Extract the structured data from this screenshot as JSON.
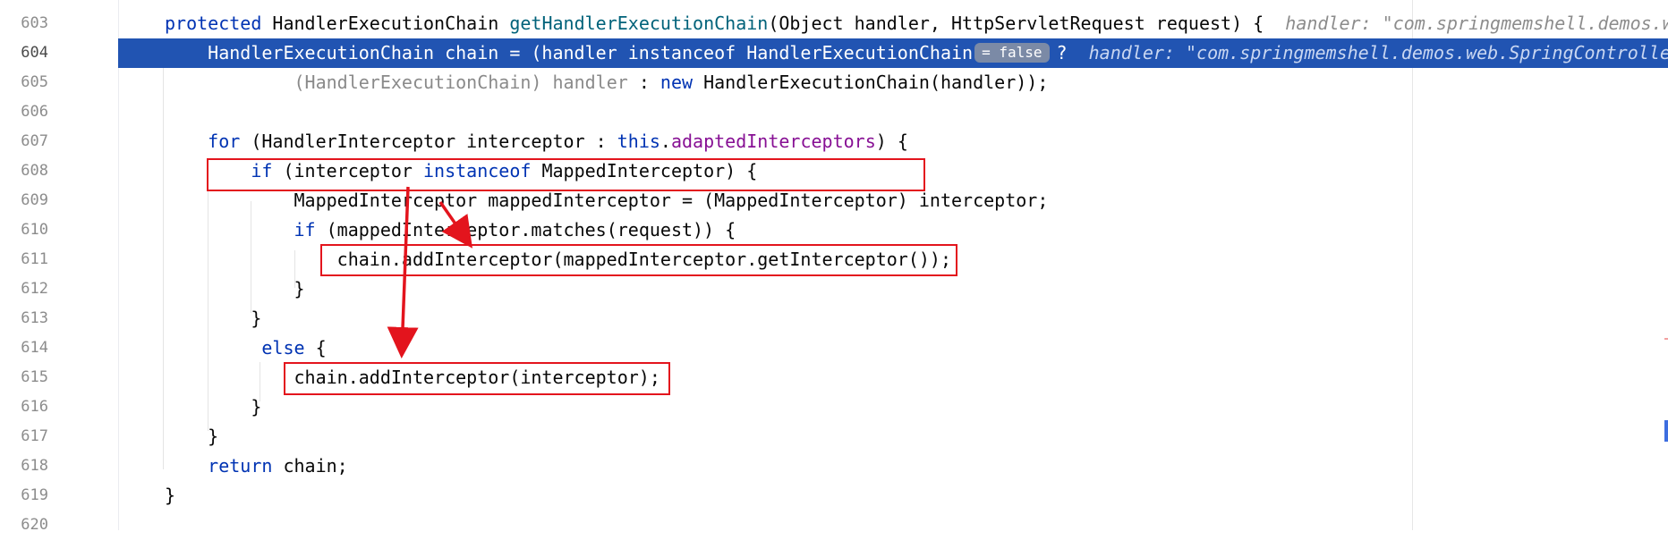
{
  "editor": {
    "lines": [
      {
        "num": "603",
        "parts": [
          {
            "t": "protected ",
            "c": "kw"
          },
          {
            "t": "HandlerExecutionChain "
          },
          {
            "t": "getHandlerExecutionChain",
            "c": "fn"
          },
          {
            "t": "(Object handler, HttpServletRequest request) {  "
          },
          {
            "t": "handler: \"com.springmemshell.demos.w",
            "c": "inlay-hint"
          }
        ]
      },
      {
        "num": "604",
        "current": true,
        "parts": [
          {
            "t": "    HandlerExecutionChain chain = (handler instanceof HandlerExecutionChain"
          },
          {
            "t": "= false",
            "c": "badge"
          },
          {
            "t": "?  "
          },
          {
            "t": "handler: \"com.springmemshell.demos.web.SpringControlle",
            "c": "inlay-hint"
          }
        ]
      },
      {
        "num": "605",
        "parts": [
          {
            "t": "            "
          },
          {
            "t": "(HandlerExecutionChain) handler",
            "c": "muted"
          },
          {
            "t": " : "
          },
          {
            "t": "new ",
            "c": "kw"
          },
          {
            "t": "HandlerExecutionChain(handler));"
          }
        ]
      },
      {
        "num": "606",
        "parts": []
      },
      {
        "num": "607",
        "parts": [
          {
            "t": "    "
          },
          {
            "t": "for ",
            "c": "kw"
          },
          {
            "t": "(HandlerInterceptor interceptor : "
          },
          {
            "t": "this",
            "c": "kw"
          },
          {
            "t": "."
          },
          {
            "t": "adaptedInterceptors",
            "c": "field"
          },
          {
            "t": ") {"
          }
        ]
      },
      {
        "num": "608",
        "parts": [
          {
            "t": "        "
          },
          {
            "t": "if ",
            "c": "kw"
          },
          {
            "t": "(interceptor "
          },
          {
            "t": "instanceof ",
            "c": "kw"
          },
          {
            "t": "MappedInterceptor) {"
          }
        ]
      },
      {
        "num": "609",
        "parts": [
          {
            "t": "            MappedInterceptor mappedInterceptor = (MappedInterceptor) interceptor;"
          }
        ]
      },
      {
        "num": "610",
        "parts": [
          {
            "t": "            "
          },
          {
            "t": "if ",
            "c": "kw"
          },
          {
            "t": "(mappedInterceptor.matches(request)) {"
          }
        ]
      },
      {
        "num": "611",
        "parts": [
          {
            "t": "                chain.addInterceptor(mappedInterceptor.getInterceptor());"
          }
        ]
      },
      {
        "num": "612",
        "parts": [
          {
            "t": "            }"
          }
        ]
      },
      {
        "num": "613",
        "parts": [
          {
            "t": "        }"
          }
        ]
      },
      {
        "num": "614",
        "parts": [
          {
            "t": "        "
          },
          {
            "t": " else ",
            "c": "kw"
          },
          {
            "t": "{"
          }
        ]
      },
      {
        "num": "615",
        "parts": [
          {
            "t": "            chain.addInterceptor(interceptor);"
          }
        ]
      },
      {
        "num": "616",
        "parts": [
          {
            "t": "        }"
          }
        ]
      },
      {
        "num": "617",
        "parts": [
          {
            "t": "    }"
          }
        ]
      },
      {
        "num": "618",
        "parts": [
          {
            "t": "    "
          },
          {
            "t": "return ",
            "c": "kw"
          },
          {
            "t": "chain;"
          }
        ]
      },
      {
        "num": "619",
        "parts": [
          {
            "t": "}"
          }
        ]
      },
      {
        "num": "620",
        "parts": []
      }
    ]
  },
  "annotations": {
    "boxes": [
      "if-instanceof-box",
      "add-mapped-interceptor-box",
      "add-interceptor-box"
    ],
    "arrow_color": "#e3141d"
  },
  "colors": {
    "keyword": "#0033b3",
    "method": "#00627a",
    "field": "#871094",
    "current_line": "#2154b2",
    "annotation": "#e3141d"
  }
}
